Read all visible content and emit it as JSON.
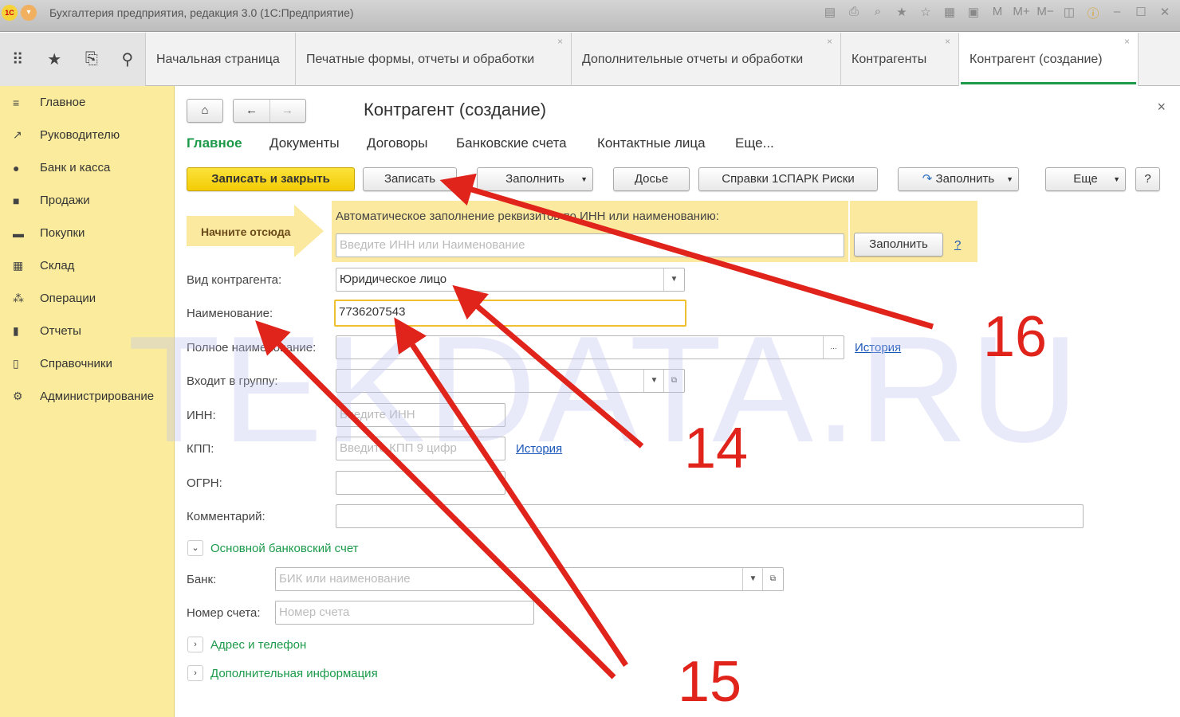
{
  "window": {
    "title": "Бухгалтерия предприятия, редакция 3.0  (1С:Предприятие)",
    "logo": "1С"
  },
  "tabs": [
    {
      "label": "Начальная страница"
    },
    {
      "label": "Печатные формы, отчеты и обработки"
    },
    {
      "label": "Дополнительные отчеты и обработки"
    },
    {
      "label": "Контрагенты"
    },
    {
      "label": "Контрагент (создание)",
      "active": true
    }
  ],
  "sidebar": {
    "items": [
      {
        "label": "Главное",
        "icon": "menu-icon"
      },
      {
        "label": "Руководителю",
        "icon": "trend-icon"
      },
      {
        "label": "Банк и касса",
        "icon": "coin-icon"
      },
      {
        "label": "Продажи",
        "icon": "bag-icon"
      },
      {
        "label": "Покупки",
        "icon": "cart-icon"
      },
      {
        "label": "Склад",
        "icon": "warehouse-icon"
      },
      {
        "label": "Операции",
        "icon": "operations-icon"
      },
      {
        "label": "Отчеты",
        "icon": "chart-icon"
      },
      {
        "label": "Справочники",
        "icon": "book-icon"
      },
      {
        "label": "Администрирование",
        "icon": "gear-icon"
      }
    ]
  },
  "form": {
    "title": "Контрагент (создание)",
    "tabs": [
      "Главное",
      "Документы",
      "Договоры",
      "Банковские счета",
      "Контактные лица",
      "Еще..."
    ],
    "toolbar": {
      "save_close": "Записать и закрыть",
      "save": "Записать",
      "fill": "Заполнить",
      "dossier": "Досье",
      "spark": "Справки 1СПАРК Риски",
      "fill2": "Заполнить",
      "more": "Еще",
      "help": "?"
    },
    "start_here": "Начните отсюда",
    "autofill": {
      "label": "Автоматическое заполнение реквизитов по ИНН или наименованию:",
      "placeholder": "Введите ИНН или Наименование",
      "button": "Заполнить",
      "help": "?"
    },
    "fields": {
      "kind": {
        "label": "Вид контрагента:",
        "value": "Юридическое лицо"
      },
      "name": {
        "label": "Наименование:",
        "value": "7736207543"
      },
      "fullname": {
        "label": "Полное наименование:",
        "history": "История",
        "btn": "..."
      },
      "group": {
        "label": "Входит в группу:"
      },
      "inn": {
        "label": "ИНН:",
        "placeholder": "Введите ИНН"
      },
      "kpp": {
        "label": "КПП:",
        "placeholder": "Введите КПП 9 цифр",
        "history": "История"
      },
      "ogrn": {
        "label": "ОГРН:"
      },
      "comment": {
        "label": "Комментарий:"
      }
    },
    "bank_section": {
      "title": "Основной банковский счет",
      "bank_label": "Банк:",
      "bank_placeholder": "БИК или наименование",
      "account_label": "Номер счета:",
      "account_placeholder": "Номер счета"
    },
    "sections": [
      "Адрес и телефон",
      "Дополнительная информация"
    ]
  },
  "watermark": "TEKDATA.RU",
  "annotations": {
    "n14": "14",
    "n15": "15",
    "n16": "16",
    "color": "#e0241b"
  }
}
